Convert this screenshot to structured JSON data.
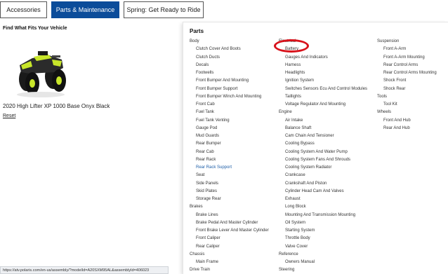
{
  "tabs": [
    {
      "label": "Accessories"
    },
    {
      "label": "Parts & Maintenance",
      "active": true
    },
    {
      "label": "Spring: Get Ready to Ride"
    }
  ],
  "fit": {
    "title": "Find What Fits Your Vehicle",
    "vehicle_name": "2020 High Lifter XP 1000 Base Onyx Black",
    "reset": "Reset"
  },
  "parts": {
    "title": "Parts",
    "columns": [
      {
        "groups": [
          {
            "category": "Body",
            "items": [
              "Clutch Cover And Boots",
              "Clutch Ducts",
              "Decals",
              "Footwells",
              "Front Bumper And Mounting",
              "Front Bumper Support",
              "Front Bumper Winch And Mounting",
              "Front Cab",
              "Fuel Tank",
              "Fuel Tank Venting",
              "Gauge Pod",
              "Mud Guards",
              "Rear Bumper",
              "Rear Cab",
              "Rear Rack",
              "Rear Rack Support",
              "Seat",
              "Side Panels",
              "Skid Plates",
              "Storage Rear"
            ]
          },
          {
            "category": "Brakes",
            "items": [
              "Brake Lines",
              "Brake Pedal And Master Cylinder",
              "Front Brake Lever And Master Cylinder",
              "Front Caliper",
              "Rear Caliper"
            ]
          },
          {
            "category": "Chassis",
            "items": [
              "Main Frame"
            ]
          },
          {
            "category": "Drive Train",
            "items": []
          }
        ]
      },
      {
        "groups": [
          {
            "category": "Electrical",
            "items": [
              "Battery",
              "Gauges And Indicators",
              "Harness",
              "Headlights",
              "Ignition System",
              "Switches Sensors Ecu And Control Modules",
              "Taillights",
              "Voltage Regulator And Mounting"
            ]
          },
          {
            "category": "Engine",
            "items": [
              "Air Intake",
              "Balance Shaft",
              "Cam Chain And Tensioner",
              "Cooling Bypass",
              "Cooling System And Water Pump",
              "Cooling System Fans And Shrouds",
              "Cooling System Radiator",
              "Crankcase",
              "Crankshaft And Piston",
              "Cylinder Head Cam And Valves",
              "Exhaust",
              "Long Block",
              "Mounting And Transmission Mounting",
              "Oil System",
              "Starting System",
              "Throttle Body",
              "Valve Cover"
            ]
          },
          {
            "category": "Reference",
            "items": [
              "Owners Manual"
            ]
          },
          {
            "category": "Steering",
            "items": []
          }
        ]
      },
      {
        "groups": [
          {
            "category": "Suspension",
            "items": [
              "Front A-Arm",
              "Front A-Arm Mounting",
              "Rear Control Arms",
              "Rear Control Arms Mounting",
              "Shock Front",
              "Shock Rear"
            ]
          },
          {
            "category": "Tools",
            "items": [
              "Tool Kit"
            ]
          },
          {
            "category": "Wheels",
            "items": [
              "Front And Hub",
              "Rear And Hub"
            ]
          }
        ]
      }
    ],
    "hovered_item": "Rear Rack Support",
    "circled_item": "Battery"
  },
  "status_url": "https://atv.polaris.com/en-us/assembly/?modelId=A20SXM95AL&assemblyId=406023",
  "colors": {
    "active_tab": "#0b4c9a",
    "link_hover": "#1f5fa8",
    "annotation": "#d8121b"
  }
}
